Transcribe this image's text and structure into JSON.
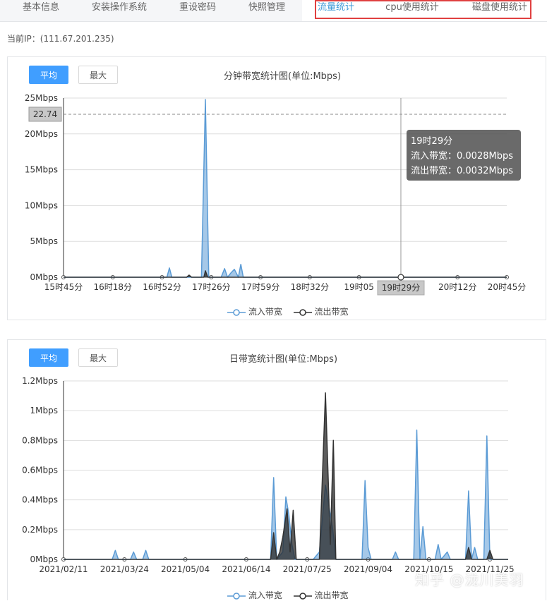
{
  "tabs": [
    {
      "label": "基本信息"
    },
    {
      "label": "安装操作系统"
    },
    {
      "label": "重设密码"
    },
    {
      "label": "快照管理"
    },
    {
      "label": "流量统计"
    },
    {
      "label": "cpu使用统计"
    },
    {
      "label": "磁盘使用统计"
    }
  ],
  "ip_label": "当前IP：(111.67.201.235)",
  "colors": {
    "in": "#5b9bd5",
    "out": "#333333",
    "accent": "#409eff",
    "highlight": "#e04040"
  },
  "minute_panel": {
    "btn_avg": "平均",
    "btn_max": "最大",
    "title": "分钟带宽统计图(单位:Mbps)",
    "marker_value": "22.74",
    "crosshair_label": "19时29分",
    "tooltip": {
      "time": "19时29分",
      "in": "流入带宽：0.0028Mbps",
      "out": "流出带宽：0.0032Mbps"
    },
    "legend": {
      "in": "流入带宽",
      "out": "流出带宽"
    }
  },
  "daily_panel": {
    "btn_avg": "平均",
    "btn_max": "最大",
    "title": "日带宽统计图(单位:Mbps)",
    "legend": {
      "in": "流入带宽",
      "out": "流出带宽"
    }
  },
  "watermark": "知乎 @泷川美羽",
  "chart_data": [
    {
      "type": "area",
      "title": "分钟带宽统计图(单位:Mbps)",
      "y_ticks": [
        "0Mbps",
        "5Mbps",
        "10Mbps",
        "15Mbps",
        "20Mbps",
        "25Mbps"
      ],
      "ylim": [
        0,
        25
      ],
      "x_ticks": [
        "15时45分",
        "16时18分",
        "16时52分",
        "17时26分",
        "17时59分",
        "18时32分",
        "19时05",
        "20时12分",
        "20时45分"
      ],
      "series": [
        {
          "name": "流入带宽",
          "points": [
            [
              0,
              0
            ],
            [
              2.1,
              0
            ],
            [
              2.15,
              1.3
            ],
            [
              2.2,
              0
            ],
            [
              2.8,
              0
            ],
            [
              2.88,
              24.8
            ],
            [
              2.95,
              0
            ],
            [
              3.2,
              0
            ],
            [
              3.27,
              1.2
            ],
            [
              3.33,
              0
            ],
            [
              3.4,
              0.6
            ],
            [
              3.47,
              1.1
            ],
            [
              3.55,
              0
            ],
            [
              3.6,
              1.8
            ],
            [
              3.65,
              0
            ],
            [
              9,
              0
            ]
          ]
        },
        {
          "name": "流出带宽",
          "points": [
            [
              0,
              0
            ],
            [
              2.5,
              0
            ],
            [
              2.55,
              0.3
            ],
            [
              2.6,
              0
            ],
            [
              2.85,
              0
            ],
            [
              2.88,
              0.9
            ],
            [
              2.93,
              0
            ],
            [
              9,
              0
            ]
          ]
        }
      ]
    },
    {
      "type": "area",
      "title": "日带宽统计图(单位:Mbps)",
      "y_ticks": [
        "0Mbps",
        "0.2Mbps",
        "0.4Mbps",
        "0.6Mbps",
        "0.8Mbps",
        "1Mbps",
        "1.2Mbps"
      ],
      "ylim": [
        0,
        1.2
      ],
      "x_ticks": [
        "2021/02/11",
        "2021/03/24",
        "2021/05/04",
        "2021/06/14",
        "2021/07/25",
        "2021/09/04",
        "2021/10/15",
        "2021/11/25"
      ],
      "series": [
        {
          "name": "流入带宽",
          "points": [
            [
              0,
              0
            ],
            [
              0.8,
              0
            ],
            [
              0.85,
              0.06
            ],
            [
              0.9,
              0
            ],
            [
              1.1,
              0
            ],
            [
              1.15,
              0.05
            ],
            [
              1.2,
              0
            ],
            [
              1.3,
              0
            ],
            [
              1.35,
              0.06
            ],
            [
              1.4,
              0
            ],
            [
              3.4,
              0
            ],
            [
              3.45,
              0.55
            ],
            [
              3.5,
              0
            ],
            [
              3.6,
              0.05
            ],
            [
              3.65,
              0.42
            ],
            [
              3.7,
              0.3
            ],
            [
              3.75,
              0.1
            ],
            [
              3.8,
              0
            ],
            [
              4.1,
              0
            ],
            [
              4.2,
              0.05
            ],
            [
              4.3,
              0.5
            ],
            [
              4.38,
              0.3
            ],
            [
              4.42,
              0.2
            ],
            [
              4.47,
              0
            ],
            [
              4.9,
              0
            ],
            [
              4.95,
              0.53
            ],
            [
              5.0,
              0.08
            ],
            [
              5.05,
              0
            ],
            [
              5.4,
              0
            ],
            [
              5.45,
              0.05
            ],
            [
              5.5,
              0
            ],
            [
              5.75,
              0
            ],
            [
              5.8,
              0.87
            ],
            [
              5.85,
              0
            ],
            [
              5.9,
              0.22
            ],
            [
              5.95,
              0
            ],
            [
              6.1,
              0
            ],
            [
              6.15,
              0.1
            ],
            [
              6.2,
              0
            ],
            [
              6.3,
              0.05
            ],
            [
              6.35,
              0
            ],
            [
              6.6,
              0
            ],
            [
              6.65,
              0.46
            ],
            [
              6.7,
              0
            ],
            [
              6.75,
              0.08
            ],
            [
              6.8,
              0
            ],
            [
              6.9,
              0
            ],
            [
              6.95,
              0.83
            ],
            [
              7.0,
              0
            ],
            [
              7.3,
              0
            ]
          ]
        },
        {
          "name": "流出带宽",
          "points": [
            [
              0,
              0
            ],
            [
              3.4,
              0
            ],
            [
              3.45,
              0.18
            ],
            [
              3.5,
              0
            ],
            [
              3.55,
              0.05
            ],
            [
              3.6,
              0.15
            ],
            [
              3.67,
              0.34
            ],
            [
              3.72,
              0.05
            ],
            [
              3.77,
              0.33
            ],
            [
              3.82,
              0
            ],
            [
              4.2,
              0
            ],
            [
              4.3,
              1.12
            ],
            [
              4.38,
              0.1
            ],
            [
              4.43,
              0.8
            ],
            [
              4.47,
              0
            ],
            [
              6.6,
              0
            ],
            [
              6.65,
              0.08
            ],
            [
              6.7,
              0
            ],
            [
              6.95,
              0
            ],
            [
              7.0,
              0.06
            ],
            [
              7.05,
              0
            ],
            [
              7.3,
              0
            ]
          ]
        }
      ]
    }
  ]
}
